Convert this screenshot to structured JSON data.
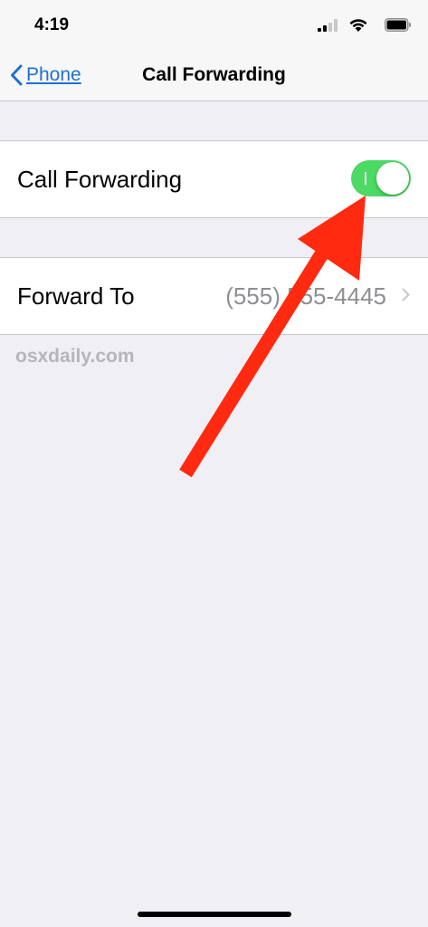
{
  "status_bar": {
    "time": "4:19"
  },
  "nav": {
    "back_label": "Phone",
    "title": "Call Forwarding"
  },
  "settings": {
    "call_forwarding": {
      "label": "Call Forwarding",
      "enabled": true
    },
    "forward_to": {
      "label": "Forward To",
      "value": "(555) 555-4445"
    }
  },
  "watermark": "osxdaily.com",
  "colors": {
    "accent": "#1f6fd6",
    "toggle_on": "#4cd964",
    "annotation_arrow": "#ff2a10",
    "background": "#efeff4"
  }
}
